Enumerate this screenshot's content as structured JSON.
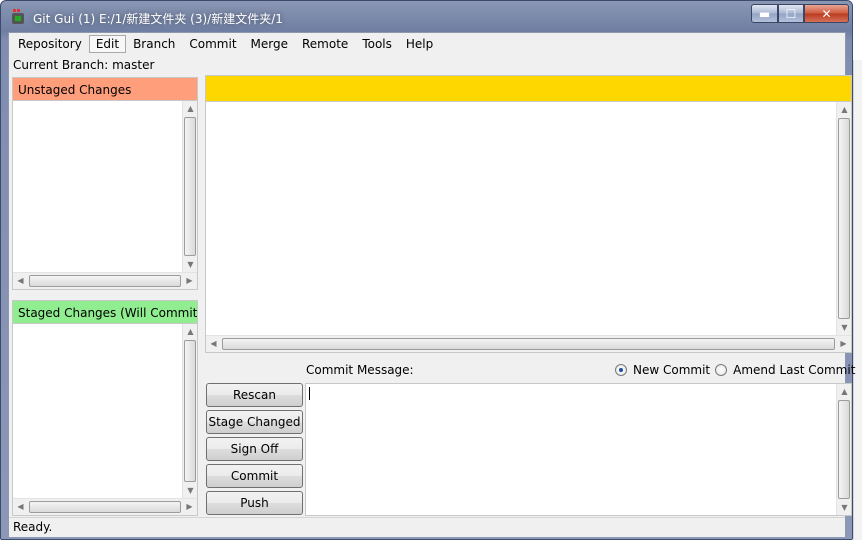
{
  "window": {
    "title": "Git Gui (1) E:/1/新建文件夹 (3)/新建文件夹/1",
    "min_glyph": "▬",
    "max_glyph": "☐",
    "close_glyph": "✕"
  },
  "menu": {
    "items": [
      {
        "label": "Repository"
      },
      {
        "label": "Edit"
      },
      {
        "label": "Branch"
      },
      {
        "label": "Commit"
      },
      {
        "label": "Merge"
      },
      {
        "label": "Remote"
      },
      {
        "label": "Tools"
      },
      {
        "label": "Help"
      }
    ],
    "active_index": 1
  },
  "branch": {
    "label": "Current Branch: master"
  },
  "panes": {
    "unstaged_title": "Unstaged Changes",
    "staged_title": "Staged Changes (Will Commit)"
  },
  "commit": {
    "message_label": "Commit Message:",
    "new_commit_label": "New Commit",
    "amend_label": "Amend Last Commit",
    "selected": "New Commit",
    "message_value": ""
  },
  "buttons": {
    "rescan": "Rescan",
    "stage_changed": "Stage Changed",
    "sign_off": "Sign Off",
    "commit": "Commit",
    "push": "Push"
  },
  "status": {
    "text": "Ready."
  },
  "scroll_glyphs": {
    "up": "▲",
    "down": "▼",
    "left": "◀",
    "right": "▶"
  },
  "colors": {
    "unstaged_header": "#ff9e7b",
    "staged_header": "#90ee90",
    "diff_header": "#ffd700"
  }
}
